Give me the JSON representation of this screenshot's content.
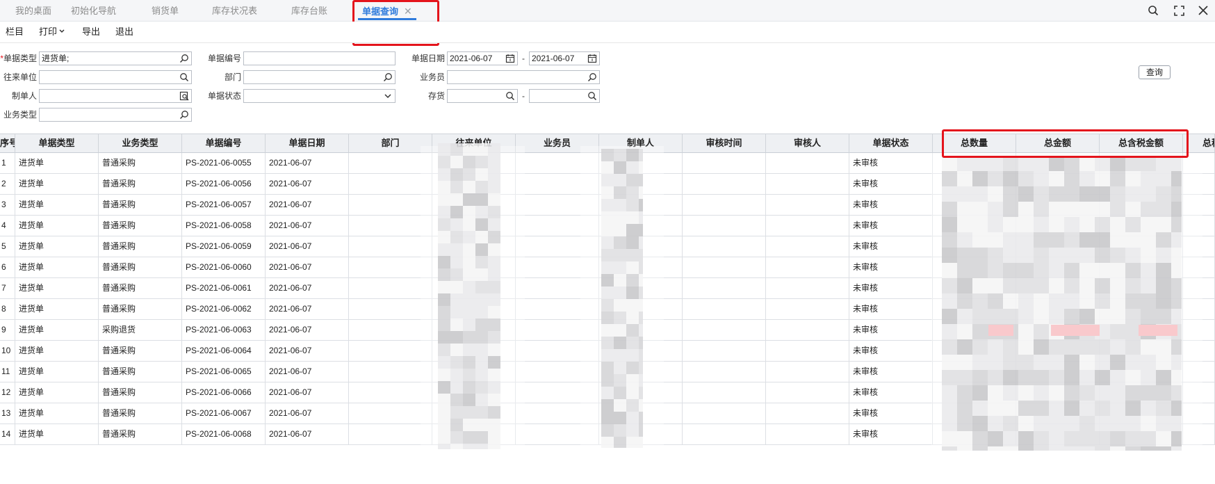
{
  "tabs": [
    {
      "label": "我的桌面"
    },
    {
      "label": "初始化导航"
    },
    {
      "label": "销货单"
    },
    {
      "label": "库存状况表"
    },
    {
      "label": "库存台账"
    },
    {
      "label": "单据查询",
      "active": true
    }
  ],
  "window_icons": [
    "search-icon",
    "maximize-icon",
    "close-icon"
  ],
  "toolbar": {
    "columns_label": "栏目",
    "print_label": "打印",
    "export_label": "导出",
    "exit_label": "退出"
  },
  "form": {
    "doc_type": {
      "label": "单据类型",
      "value": "进货单;"
    },
    "doc_no": {
      "label": "单据编号",
      "value": ""
    },
    "doc_date": {
      "label": "单据日期",
      "from": "2021-06-07",
      "to": "2021-06-07",
      "sep": "-"
    },
    "partner": {
      "label": "往来单位",
      "value": ""
    },
    "department": {
      "label": "部门",
      "value": ""
    },
    "salesperson": {
      "label": "业务员",
      "value": ""
    },
    "creator": {
      "label": "制单人",
      "value": ""
    },
    "doc_status": {
      "label": "单据状态",
      "value": ""
    },
    "inventory": {
      "label": "存货",
      "from": "",
      "to": "",
      "sep": "-"
    },
    "biz_type": {
      "label": "业务类型",
      "value": ""
    },
    "query_label": "查询"
  },
  "table": {
    "headers": [
      "序号",
      "单据类型",
      "业务类型",
      "单据编号",
      "单据日期",
      "部门",
      "往来单位",
      "业务员",
      "制单人",
      "审核时间",
      "审核人",
      "单据状态",
      "总数量",
      "总金额",
      "总含税金额",
      "总税"
    ],
    "rows": [
      {
        "no": "1",
        "type": "进货单",
        "biz": "普通采购",
        "code": "PS-2021-06-0055",
        "date": "2021-06-07",
        "status": "未审核"
      },
      {
        "no": "2",
        "type": "进货单",
        "biz": "普通采购",
        "code": "PS-2021-06-0056",
        "date": "2021-06-07",
        "status": "未审核"
      },
      {
        "no": "3",
        "type": "进货单",
        "biz": "普通采购",
        "code": "PS-2021-06-0057",
        "date": "2021-06-07",
        "status": "未审核"
      },
      {
        "no": "4",
        "type": "进货单",
        "biz": "普通采购",
        "code": "PS-2021-06-0058",
        "date": "2021-06-07",
        "status": "未审核"
      },
      {
        "no": "5",
        "type": "进货单",
        "biz": "普通采购",
        "code": "PS-2021-06-0059",
        "date": "2021-06-07",
        "status": "未审核"
      },
      {
        "no": "6",
        "type": "进货单",
        "biz": "普通采购",
        "code": "PS-2021-06-0060",
        "date": "2021-06-07",
        "status": "未审核"
      },
      {
        "no": "7",
        "type": "进货单",
        "biz": "普通采购",
        "code": "PS-2021-06-0061",
        "date": "2021-06-07",
        "status": "未审核"
      },
      {
        "no": "8",
        "type": "进货单",
        "biz": "普通采购",
        "code": "PS-2021-06-0062",
        "date": "2021-06-07",
        "status": "未审核"
      },
      {
        "no": "9",
        "type": "进货单",
        "biz": "采购退货",
        "code": "PS-2021-06-0063",
        "date": "2021-06-07",
        "status": "未审核"
      },
      {
        "no": "10",
        "type": "进货单",
        "biz": "普通采购",
        "code": "PS-2021-06-0064",
        "date": "2021-06-07",
        "status": "未审核"
      },
      {
        "no": "11",
        "type": "进货单",
        "biz": "普通采购",
        "code": "PS-2021-06-0065",
        "date": "2021-06-07",
        "status": "未审核"
      },
      {
        "no": "12",
        "type": "进货单",
        "biz": "普通采购",
        "code": "PS-2021-06-0066",
        "date": "2021-06-07",
        "status": "未审核"
      },
      {
        "no": "13",
        "type": "进货单",
        "biz": "普通采购",
        "code": "PS-2021-06-0067",
        "date": "2021-06-07",
        "status": "未审核"
      },
      {
        "no": "14",
        "type": "进货单",
        "biz": "普通采购",
        "code": "PS-2021-06-0068",
        "date": "2021-06-07",
        "status": "未审核"
      }
    ]
  },
  "colors": {
    "accent": "#2f7bdc",
    "highlight": "#e4141c",
    "header_bg": "#eef0f3"
  }
}
